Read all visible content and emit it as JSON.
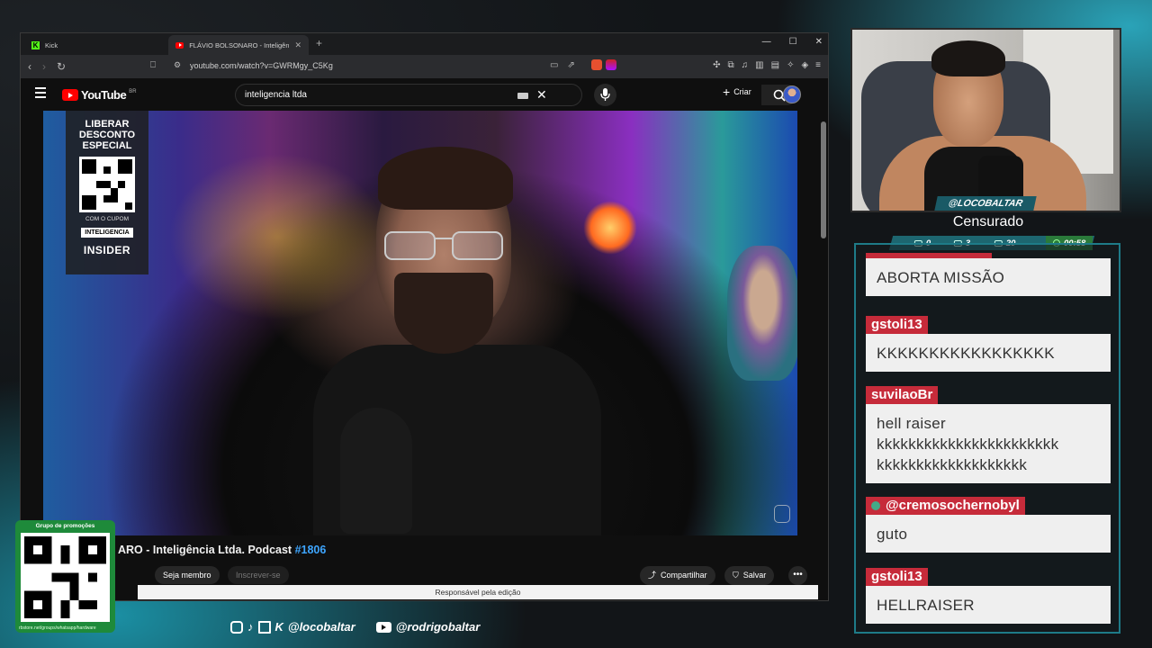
{
  "browser": {
    "tabs": [
      {
        "label": "Kick"
      },
      {
        "label": "FLÁVIO BOLSONARO - Inteligência"
      }
    ],
    "url": "youtube.com/watch?v=GWRMgy_C5Kg"
  },
  "youtube": {
    "logo_text": "YouTube",
    "country_code": "BR",
    "search_value": "inteligencia ltda",
    "create_label": "Criar",
    "video_title_text": "ARO - Inteligência Ltda. Podcast ",
    "video_title_tag": "#1806",
    "member_label": "Seja membro",
    "subscribe_label": "Inscrever-se",
    "share_label": "Compartilhar",
    "save_label": "Salvar",
    "editor_credit": "Responsável pela edição",
    "promo": {
      "headline_1": "LIBERAR",
      "headline_2": "DESCONTO",
      "headline_3": "ESPECIAL",
      "coupon_text": "COM O CUPOM",
      "coupon_code": "INTELIGENCIA",
      "brand": "INSIDER"
    }
  },
  "stream": {
    "handle": "@LOCOBALTAR",
    "status": "Censurado",
    "stats": {
      "a": "0",
      "b": "3",
      "c": "20",
      "timer": "00:58"
    }
  },
  "chat": [
    {
      "user": "",
      "text": "ABORTA MISSÃO"
    },
    {
      "user": "gstoli13",
      "text": "KKKKKKKKKKKKKKKKK"
    },
    {
      "user": "suvilaoBr",
      "text": "hell raiser kkkkkkkkkkkkkkkkkkkkkkk kkkkkkkkkkkkkkkkkkk"
    },
    {
      "user": "@cremosochernobyl",
      "text": "guto"
    },
    {
      "user": "gstoli13",
      "text": "HELLRAISER"
    }
  ],
  "overlay": {
    "qr_label": "Grupo de promoções",
    "qr_url": "rbstore.net/groups/whatsapp/hardware",
    "social_handle_1": "@locobaltar",
    "social_handle_2": "@rodrigobaltar"
  },
  "colors": {
    "youtube_red": "#ff0000",
    "chat_username_bg": "#c62b3a",
    "accent_teal": "#1e7b88",
    "timer_green": "#2a7a3a",
    "qr_card_green": "#1e8a3a"
  }
}
